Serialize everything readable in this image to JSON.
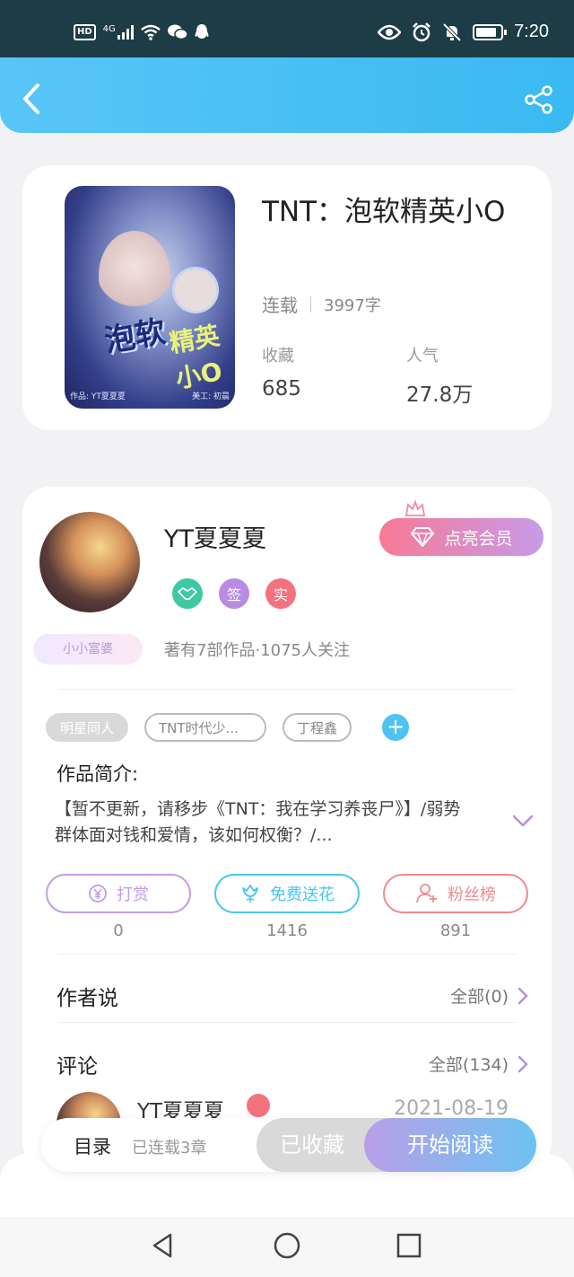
{
  "statusbar": {
    "hd": "HD",
    "network": "4G",
    "time": "7:20"
  },
  "header": {
    "back_icon": "chevron-left-icon",
    "share_icon": "share-icon",
    "bg_color": "#4bbff4"
  },
  "book": {
    "title": "TNT：泡软精英小O",
    "status": "连载",
    "word_count": "3997字",
    "stats": [
      {
        "label": "收藏",
        "value": "685"
      },
      {
        "label": "人气",
        "value": "27.8万"
      }
    ],
    "cover": {
      "title_a": "泡软",
      "title_b": "精英小O",
      "footer_left": "作品: YT夏夏夏",
      "footer_right": "美工: 初晨"
    }
  },
  "author": {
    "name": "YT夏夏夏",
    "badge_label": "小小富婆",
    "vip_button": "点亮会员",
    "badges": [
      {
        "label": "",
        "icon": "handshake-icon",
        "color": "#3dc9a4"
      },
      {
        "label": "签",
        "icon": "sign-icon",
        "color": "#b98be3"
      },
      {
        "label": "实",
        "icon": "verified-icon",
        "color": "#f2737e"
      }
    ],
    "meta": "著有7部作品·1075人关注"
  },
  "tags": [
    "明星同人",
    "TNT时代少...",
    "丁程鑫"
  ],
  "intro": {
    "label": "作品简介:",
    "text": "【暂不更新，请移步《TNT：我在学习养丧尸》】/弱势群体面对钱和爱情，该如何权衡？/..."
  },
  "actions": [
    {
      "label": "打赏",
      "count": "0",
      "icon": "yen-icon",
      "color": "#c29be6"
    },
    {
      "label": "免费送花",
      "count": "1416",
      "icon": "flower-icon",
      "color": "#48c6ee"
    },
    {
      "label": "粉丝榜",
      "count": "891",
      "icon": "fans-icon",
      "color": "#f08a8e"
    }
  ],
  "author_says": {
    "title": "作者说",
    "all": "全部(0)"
  },
  "comments": {
    "title": "评论",
    "all": "全部(134)",
    "first": {
      "name": "YT夏夏夏",
      "date": "2021-08-19"
    }
  },
  "bottom": {
    "toc": "目录",
    "toc_sub": "已连载3章",
    "fav": "已收藏",
    "read": "开始阅读"
  },
  "navbar": [
    "back-triangle-icon",
    "home-circle-icon",
    "recent-square-icon"
  ]
}
